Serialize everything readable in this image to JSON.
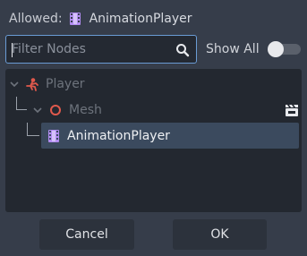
{
  "header": {
    "allowed_label": "Allowed:",
    "allowed_type": "AnimationPlayer",
    "allowed_type_icon": "animation-player-icon"
  },
  "filter": {
    "placeholder": "Filter Nodes",
    "value": "",
    "search_icon": "search-icon",
    "show_all_label": "Show All",
    "show_all_enabled": false
  },
  "tree": {
    "nodes": [
      {
        "label": "Player",
        "icon": "player-node-icon",
        "expanded": true,
        "selectable": false
      },
      {
        "label": "Mesh",
        "icon": "mesh-node-icon",
        "expanded": true,
        "selectable": false,
        "badge_icon": "clapperboard-icon"
      },
      {
        "label": "AnimationPlayer",
        "icon": "animation-player-icon",
        "selected": true,
        "selectable": true
      }
    ]
  },
  "buttons": {
    "cancel": "Cancel",
    "ok": "OK"
  },
  "colors": {
    "background": "#363d4a",
    "panel": "#232830",
    "selection": "#3b4a5e",
    "input_border": "#6a9bd4",
    "accent_red": "#e0594c",
    "accent_purple": "#b18cf0"
  }
}
